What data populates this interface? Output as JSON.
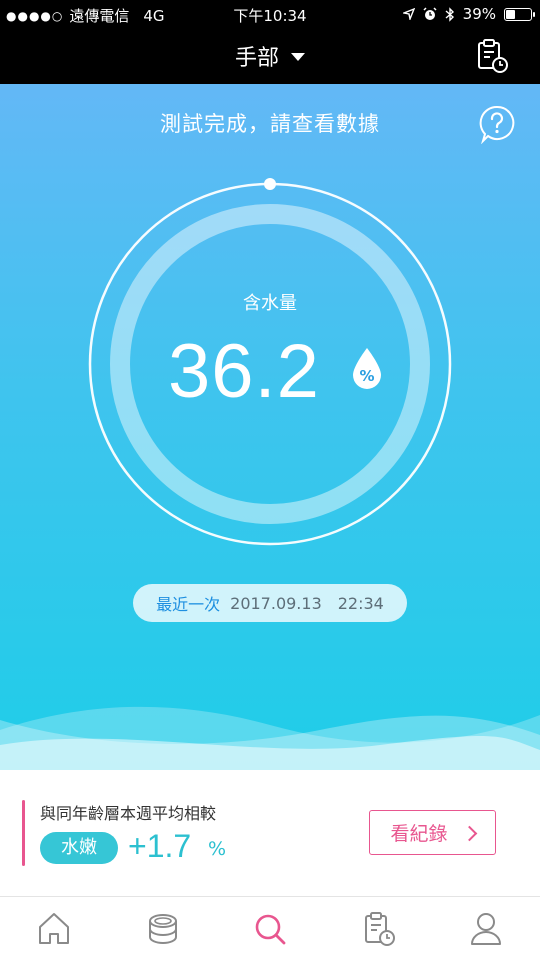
{
  "status_bar": {
    "carrier": "遠傳電信",
    "network": "4G",
    "time": "下午10:34",
    "battery_percent": "39%",
    "battery_level": 0.39,
    "icons": [
      "signal-dots-icon",
      "location-arrow-icon",
      "alarm-icon",
      "bluetooth-icon",
      "battery-icon"
    ]
  },
  "nav": {
    "title": "手部",
    "icons": [
      "dropdown-caret-icon",
      "history-clipboard-icon"
    ]
  },
  "hero": {
    "heading": "測試完成，請查看數據",
    "gauge_label": "含水量",
    "gauge_value": "36.2",
    "unit": "%",
    "last_label": "最近一次",
    "last_date": "2017.09.13",
    "last_time": "22:34",
    "icons": [
      "help-icon",
      "water-drop-icon"
    ]
  },
  "compare": {
    "title": "與同年齡層本週平均相較",
    "badge": "水嫩",
    "delta": "+1.7",
    "delta_unit": "%",
    "records_button": "看紀錄"
  },
  "tabs": [
    {
      "icon": "home-icon",
      "active": false
    },
    {
      "icon": "device-icon",
      "active": false
    },
    {
      "icon": "search-icon",
      "active": true
    },
    {
      "icon": "history-clipboard-icon",
      "active": false
    },
    {
      "icon": "user-icon",
      "active": false
    }
  ],
  "colors": {
    "accent_pink": "#e8568f",
    "accent_teal": "#2cc0d0",
    "hero_top": "#63b8f6",
    "hero_bottom": "#1fcde8"
  }
}
